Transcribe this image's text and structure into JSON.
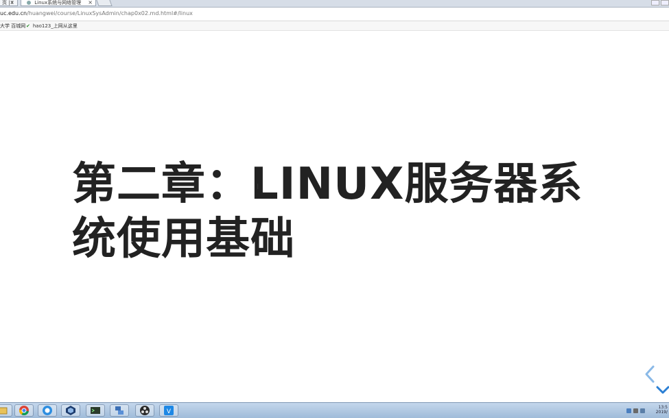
{
  "browser": {
    "tabs": [
      {
        "label": "页 | I"
      },
      {
        "label": "Linux系统与网络管理"
      }
    ],
    "close_glyph": "×",
    "url_host": "uc.edu.cn",
    "url_path": "/huangwei/course/LinuxSysAdmin/chap0x02.md.html#/linux",
    "bookmarks": [
      {
        "label": "大学 百城网"
      },
      {
        "label": "hao123_上网从这里"
      }
    ]
  },
  "slide": {
    "title": "第二章：LINUX服务器系统使用基础"
  },
  "taskbar": {
    "apps": [
      "folder-icon",
      "chrome-icon",
      "browser-icon",
      "virtualbox-icon",
      "terminal-icon",
      "network-icon",
      "obs-icon",
      "vscode-icon"
    ],
    "tray_time": "13:5",
    "tray_date": "2019/"
  },
  "colors": {
    "title": "#222222",
    "nav_arrow": "#2a7fd4",
    "taskbar": "#b5cbe4"
  }
}
